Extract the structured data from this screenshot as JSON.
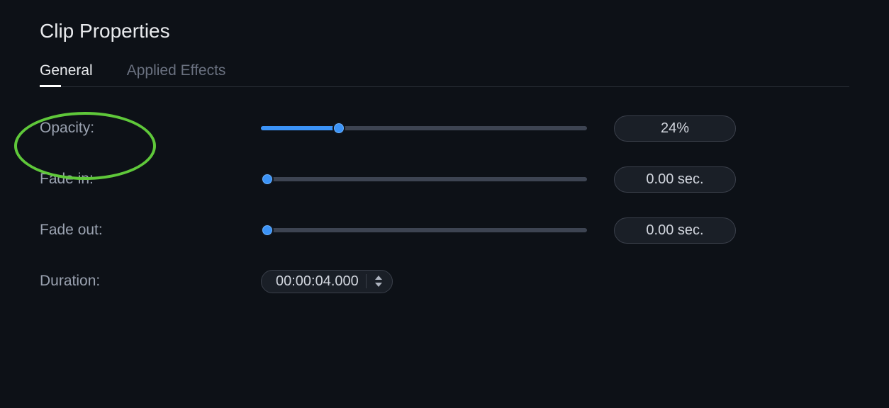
{
  "title": "Clip Properties",
  "tabs": {
    "general": "General",
    "applied_effects": "Applied Effects"
  },
  "rows": {
    "opacity": {
      "label": "Opacity:",
      "value": "24%",
      "percent": 24
    },
    "fade_in": {
      "label": "Fade in:",
      "value": "0.00 sec.",
      "percent": 0
    },
    "fade_out": {
      "label": "Fade out:",
      "value": "0.00 sec.",
      "percent": 0
    },
    "duration": {
      "label": "Duration:",
      "value": "00:00:04.000"
    }
  },
  "annotation": {
    "highlight": "opacity-label"
  }
}
